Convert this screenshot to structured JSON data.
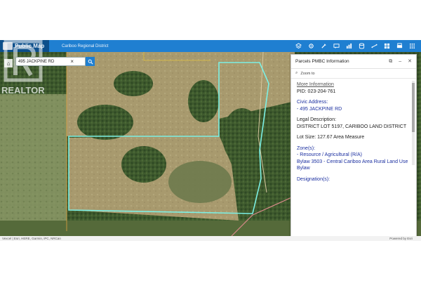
{
  "app": {
    "title": "Public Map",
    "district": "Cariboo Regional District",
    "colors": {
      "appbar": "#1f7fd1",
      "parcel_outline": "#7cf0e4",
      "panel_text": "#1b2fa0"
    }
  },
  "toolbar": {
    "icons": [
      "layers-icon",
      "settings-icon",
      "tools-icon",
      "chat-icon",
      "chart-icon",
      "database-icon",
      "measure-icon",
      "basemap-icon",
      "print-icon",
      "grid-icon"
    ]
  },
  "search": {
    "value": "495 JACKPINE RD",
    "clear_symbol": "×"
  },
  "watermark": {
    "text": "REALTOR"
  },
  "panel": {
    "title": "Parcels PMBC Information",
    "zoom_to": "Zoom to",
    "more_info": "More Information",
    "pid": "PID: 023-204-761",
    "civic_label": "Civic Address:",
    "civic_value": "- 495 JACKPINE RD",
    "legal_label": "Legal Description:",
    "legal_value": "DISTRICT LOT 5197, CARIBOO LAND DISTRICT",
    "lot_size": "Lot Size: 127.67 Area Measure",
    "zone_label": "Zone(s):",
    "zone_1": "- Resource / Agricultural (R/A)",
    "zone_2": "Bylaw 3503 - Central Cariboo Area Rural Land Use Bylaw",
    "designation_label": "Designation(s):"
  },
  "attribution": {
    "left": "Vexcel | Esri, HERE, Garmin, iPC, NRCan",
    "right": "Powered by Esri"
  }
}
